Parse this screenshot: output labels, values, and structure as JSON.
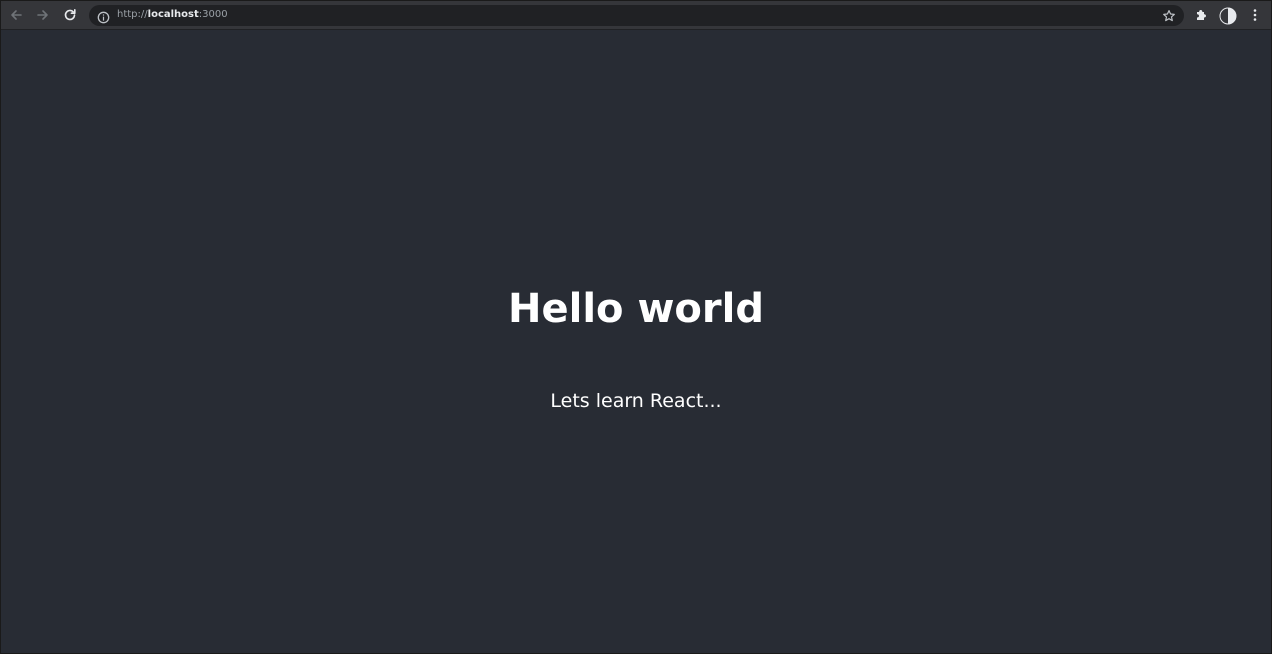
{
  "browser": {
    "url_scheme": "http://",
    "url_host": "localhost",
    "url_port": ":3000",
    "icons": {
      "back": "arrow-left-icon",
      "forward": "arrow-right-icon",
      "reload": "reload-icon",
      "site_info": "info-icon",
      "bookmark": "star-icon",
      "extensions": "puzzle-icon",
      "profile": "contrast-icon",
      "menu": "kebab-menu-icon"
    },
    "colors": {
      "toolbar": "#35363a",
      "omnibox": "#202124",
      "page_background": "#282c34"
    }
  },
  "page": {
    "heading": "Hello world",
    "subtitle": "Lets learn React..."
  }
}
